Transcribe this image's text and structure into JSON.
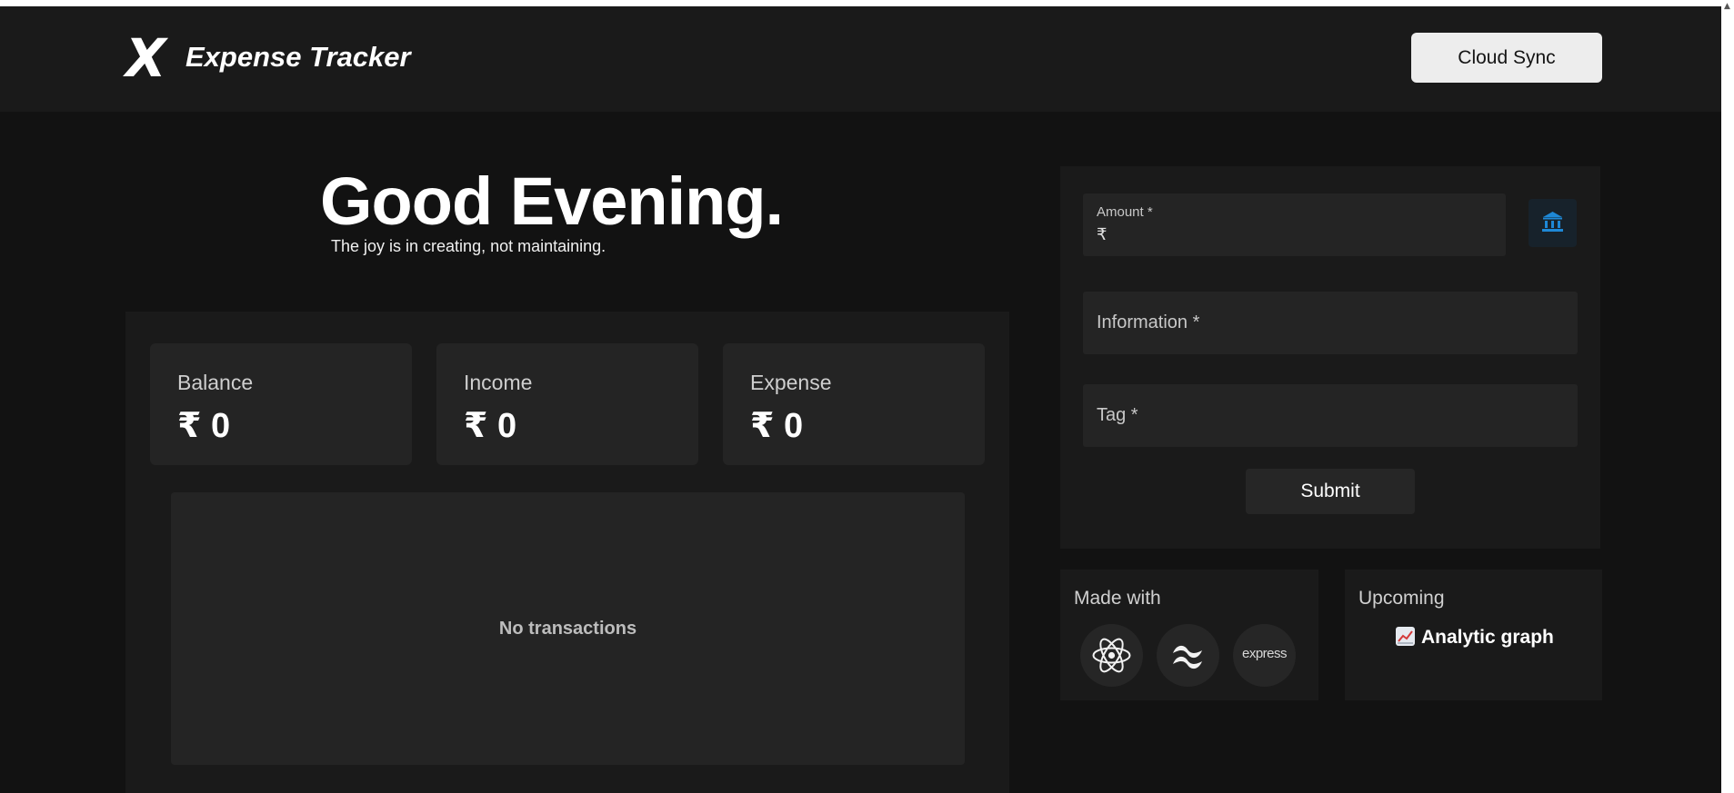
{
  "header": {
    "logo_glyph": "X",
    "title": "Expense Tracker",
    "cloud_sync_label": "Cloud Sync"
  },
  "hero": {
    "greeting": "Good Evening.",
    "tagline": "The joy is in creating, not maintaining."
  },
  "stats": [
    {
      "label": "Balance",
      "value": "₹ 0"
    },
    {
      "label": "Income",
      "value": "₹ 0"
    },
    {
      "label": "Expense",
      "value": "₹ 0"
    }
  ],
  "transactions": {
    "empty_text": "No transactions"
  },
  "form": {
    "amount": {
      "label": "Amount *",
      "value": "₹"
    },
    "information": {
      "label": "Information *",
      "value": ""
    },
    "tag": {
      "label": "Tag *",
      "value": ""
    },
    "bank_icon": "bank-icon",
    "submit_label": "Submit"
  },
  "made_with": {
    "title": "Made with",
    "items": [
      {
        "icon": "react-icon"
      },
      {
        "icon": "tailwind-icon"
      },
      {
        "icon": "express-icon",
        "text": "express"
      }
    ]
  },
  "upcoming": {
    "title": "Upcoming",
    "items": [
      {
        "icon": "chart-increasing-icon",
        "label": "Analytic graph"
      }
    ]
  },
  "colors": {
    "background": "#121212",
    "header": "#1a1a1a",
    "panel": "#1a1a1a",
    "card": "#242424",
    "bank_icon_accent": "#1e88d6",
    "cloud_button_bg": "#ededed"
  }
}
